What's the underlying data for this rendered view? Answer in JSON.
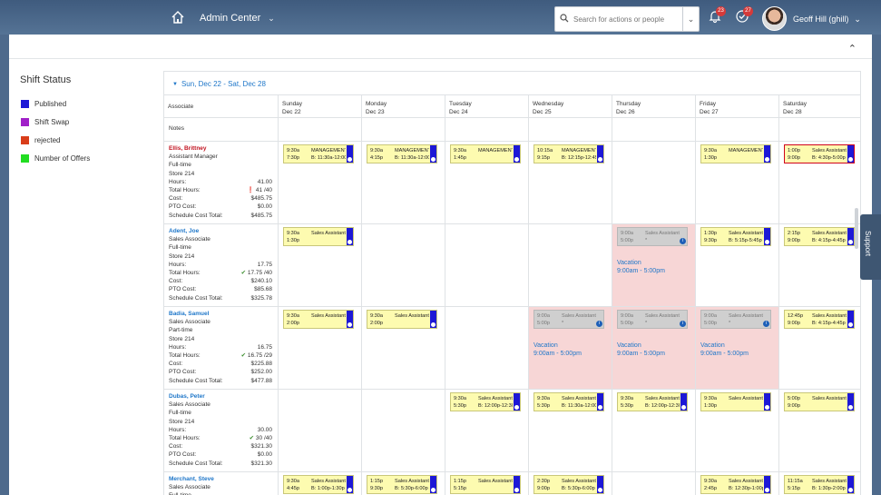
{
  "shell": {
    "module": "Admin Center",
    "search_placeholder": "Search for actions or people",
    "notifications_count": "23",
    "tasks_count": "27",
    "user_name": "Geoff Hill (ghill)"
  },
  "legend": {
    "title": "Shift Status",
    "items": [
      {
        "label": "Published",
        "color": "#1d18d6"
      },
      {
        "label": "Shift Swap",
        "color": "#a020c8"
      },
      {
        "label": "rejected",
        "color": "#d93d1a"
      },
      {
        "label": "Number of Offers",
        "color": "#22dd22"
      }
    ]
  },
  "scheduler": {
    "range": "Sun, Dec 22 - Sat, Dec 28",
    "associate_header": "Associate",
    "notes_label": "Notes",
    "days": [
      {
        "name": "Sunday",
        "date": "Dec 22"
      },
      {
        "name": "Monday",
        "date": "Dec 23"
      },
      {
        "name": "Tuesday",
        "date": "Dec 24"
      },
      {
        "name": "Wednesday",
        "date": "Dec 25"
      },
      {
        "name": "Thursday",
        "date": "Dec 26"
      },
      {
        "name": "Friday",
        "date": "Dec 27"
      },
      {
        "name": "Saturday",
        "date": "Dec 28"
      }
    ],
    "vacation_label": "Vacation",
    "vacation_time": "9:00am - 5:00pm",
    "associates": [
      {
        "name": "Ellis, Brittney",
        "role": "Assistant Manager",
        "type": "Full-time",
        "store": "Store 214",
        "hours": "41.00",
        "total_hours": "41 /40",
        "cost": "$485.75",
        "pto_cost": "$0.00",
        "schedule_cost": "$485.75",
        "shifts": [
          {
            "start": "9:30a",
            "end": "7:30p",
            "role": "MANAGEMENT",
            "brk": "B: 11:30a-12:00p"
          },
          {
            "start": "9:30a",
            "end": "4:15p",
            "role": "MANAGEMENT",
            "brk": "B: 11:30a-12:00p"
          },
          {
            "start": "9:30a",
            "end": "1:45p",
            "role": "MANAGEMENT",
            "brk": ""
          },
          {
            "start": "10:15a",
            "end": "9:15p",
            "role": "MANAGEMENT",
            "brk": "B: 12:15p-12:45p"
          },
          null,
          {
            "start": "9:30a",
            "end": "1:30p",
            "role": "MANAGEMENT",
            "brk": ""
          },
          {
            "start": "1:00p",
            "end": "9:00p",
            "role": "Sales Assistant",
            "brk": "B: 4:30p-5:00p"
          }
        ]
      },
      {
        "name": "Adent, Joe",
        "role": "Sales Associate",
        "type": "Full-time",
        "store": "Store 214",
        "hours": "17.75",
        "total_hours": "17.75 /40",
        "cost": "$240.10",
        "pto_cost": "$85.68",
        "schedule_cost": "$325.78",
        "shifts": [
          {
            "start": "9:30a",
            "end": "1:30p",
            "role": "Sales Assistant",
            "brk": ""
          },
          null,
          null,
          null,
          {
            "start": "9:00a",
            "end": "5:00p",
            "role": "Sales Assistant",
            "brk": "*"
          },
          {
            "start": "1:30p",
            "end": "9:30p",
            "role": "Sales Assistant",
            "brk": "B: 5:15p-5:45p"
          },
          {
            "start": "2:15p",
            "end": "9:00p",
            "role": "Sales Assistant",
            "brk": "B: 4:15p-4:45p"
          }
        ]
      },
      {
        "name": "Badia, Samuel",
        "role": "Sales Associate",
        "type": "Part-time",
        "store": "Store 214",
        "hours": "16.75",
        "total_hours": "16.75 /29",
        "cost": "$225.88",
        "pto_cost": "$252.00",
        "schedule_cost": "$477.88",
        "shifts": [
          {
            "start": "9:30a",
            "end": "2:00p",
            "role": "Sales Assistant",
            "brk": ""
          },
          {
            "start": "9:30a",
            "end": "2:00p",
            "role": "Sales Assistant",
            "brk": ""
          },
          null,
          {
            "start": "9:00a",
            "end": "5:00p",
            "role": "Sales Assistant",
            "brk": "*"
          },
          {
            "start": "9:00a",
            "end": "5:00p",
            "role": "Sales Assistant",
            "brk": "*"
          },
          {
            "start": "9:00a",
            "end": "5:00p",
            "role": "Sales Assistant",
            "brk": "*"
          },
          {
            "start": "12:45p",
            "end": "9:00p",
            "role": "Sales Assistant",
            "brk": "B: 4:15p-4:45p"
          }
        ]
      },
      {
        "name": "Dubas, Peter",
        "role": "Sales Associate",
        "type": "Full-time",
        "store": "Store 214",
        "hours": "30.00",
        "total_hours": "30 /40",
        "cost": "$321.30",
        "pto_cost": "$0.00",
        "schedule_cost": "$321.30",
        "shifts": [
          null,
          null,
          {
            "start": "9:30a",
            "end": "5:30p",
            "role": "Sales Assistant",
            "brk": "B: 12:00p-12:30p"
          },
          {
            "start": "9:30a",
            "end": "5:30p",
            "role": "Sales Assistant",
            "brk": "B: 11:30a-12:00p"
          },
          {
            "start": "9:30a",
            "end": "5:30p",
            "role": "Sales Assistant",
            "brk": "B: 12:00p-12:30p"
          },
          {
            "start": "9:30a",
            "end": "1:30p",
            "role": "Sales Assistant",
            "brk": ""
          },
          {
            "start": "5:00p",
            "end": "9:00p",
            "role": "Sales Assistant",
            "brk": ""
          }
        ]
      },
      {
        "name": "Merchant, Steve",
        "role": "Sales Associate",
        "type": "Full-time",
        "store": "",
        "hours": "",
        "total_hours": "",
        "cost": "",
        "pto_cost": "",
        "schedule_cost": "",
        "shifts": [
          {
            "start": "9:30a",
            "end": "4:45p",
            "role": "Sales Assistant",
            "brk": "B: 1:00p-1:30p"
          },
          {
            "start": "1:15p",
            "end": "9:30p",
            "role": "Sales Assistant",
            "brk": "B: 5:30p-6:00p"
          },
          {
            "start": "1:15p",
            "end": "5:15p",
            "role": "Sales Assistant",
            "brk": ""
          },
          {
            "start": "2:30p",
            "end": "9:00p",
            "role": "Sales Assistant",
            "brk": "B: 5:30p-6:00p"
          },
          null,
          {
            "start": "9:30a",
            "end": "2:45p",
            "role": "Sales Assistant",
            "brk": "B: 12:30p-1:00p"
          },
          {
            "start": "11:15a",
            "end": "5:15p",
            "role": "Sales Assistant",
            "brk": "B: 1:30p-2:00p"
          }
        ]
      }
    ],
    "labels": {
      "hours": "Hours:",
      "total_hours": "Total Hours:",
      "cost": "Cost:",
      "pto_cost": "PTO Cost:",
      "schedule_cost": "Schedule Cost Total:"
    }
  },
  "support_label": "Support",
  "colors": {
    "published": "#1d18d6",
    "shift_bg": "#fdfbb0",
    "vacation_bg": "#f7d6d6",
    "link": "#1f77c9"
  }
}
